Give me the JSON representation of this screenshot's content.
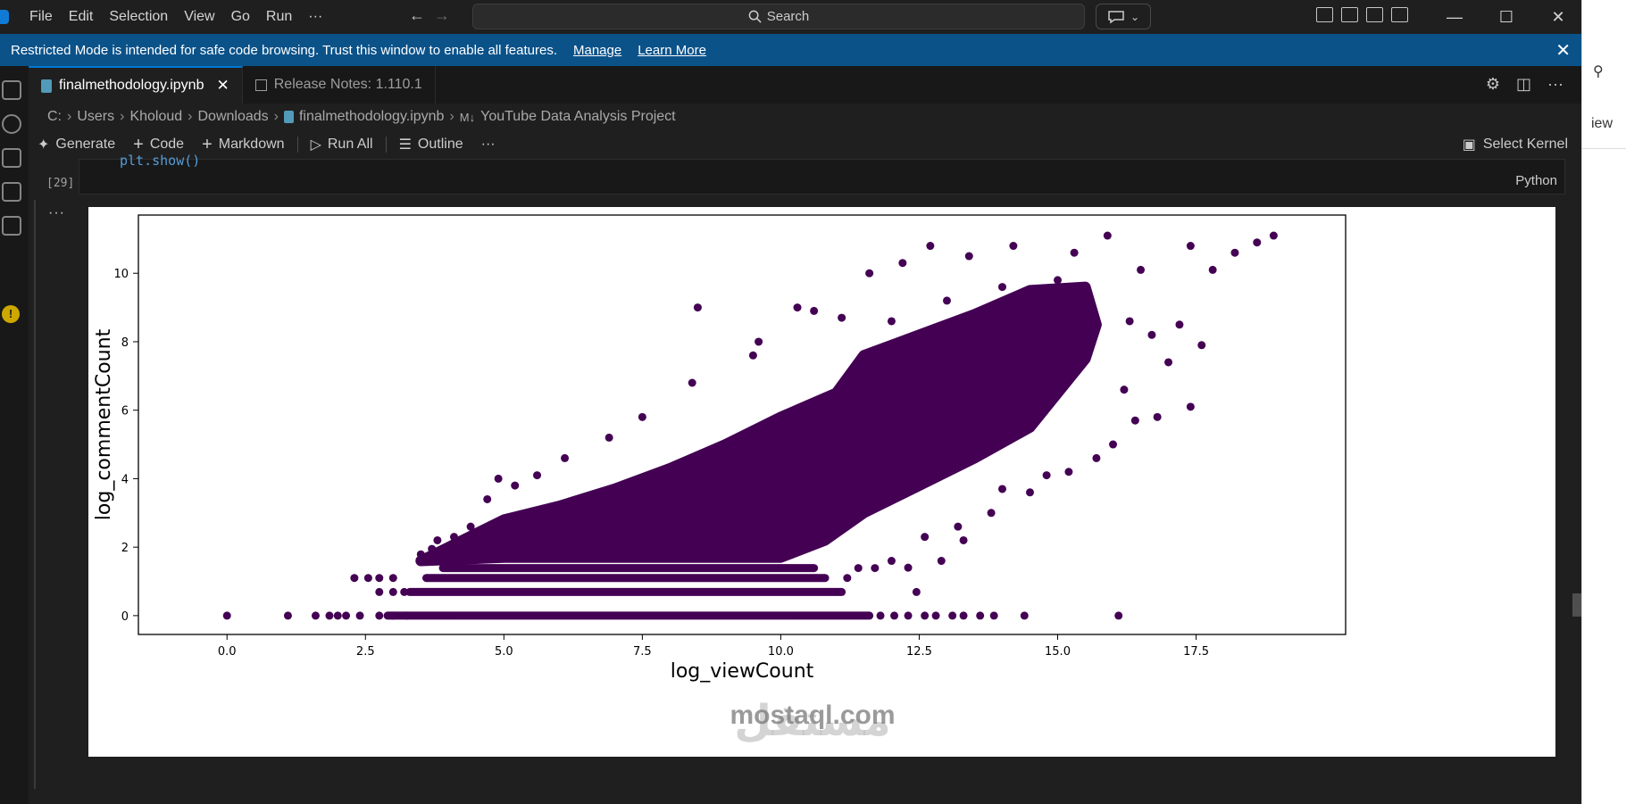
{
  "menu": [
    "File",
    "Edit",
    "Selection",
    "View",
    "Go",
    "Run",
    "···"
  ],
  "search": {
    "label": "Search"
  },
  "banner": {
    "message": "Restricted Mode is intended for safe code browsing. Trust this window to enable all features.",
    "manage": "Manage",
    "learn_more": "Learn More"
  },
  "tabs": [
    {
      "label": "finalmethodology.ipynb",
      "active": true
    },
    {
      "label": "Release Notes: 1.110.1",
      "active": false
    }
  ],
  "breadcrumb": [
    "C:",
    "Users",
    "Kholoud",
    "Downloads",
    "finalmethodology.ipynb",
    "YouTube Data Analysis Project"
  ],
  "toolbar": {
    "generate": "Generate",
    "code": "Code",
    "markdown": "Markdown",
    "run_all": "Run All",
    "outline": "Outline",
    "more": "···",
    "kernel": "Select Kernel"
  },
  "cell": {
    "code": "plt.show()",
    "execution_count": "[29]",
    "language": "Python",
    "output_menu": "···"
  },
  "side_window": {
    "text": "iew"
  },
  "watermark": {
    "latin": "mostaql.com",
    "arabic": "مستقل"
  },
  "colors": {
    "banner": "#0b5289",
    "accent": "#0078d4",
    "point": "#440154"
  },
  "chart_data": {
    "type": "scatter",
    "xlabel": "log_viewCount",
    "ylabel": "log_commentCount",
    "xlim": [
      -1.6,
      20.2
    ],
    "ylim": [
      -0.55,
      11.7
    ],
    "xticks": [
      0.0,
      2.5,
      5.0,
      7.5,
      10.0,
      12.5,
      15.0,
      17.5
    ],
    "yticks": [
      0,
      2,
      4,
      6,
      8,
      10
    ],
    "grid": false,
    "point_color": "#440154",
    "dense_region": [
      [
        3.5,
        1.6
      ],
      [
        4.0,
        2.0
      ],
      [
        5.0,
        2.8
      ],
      [
        6.0,
        3.2
      ],
      [
        7.0,
        3.7
      ],
      [
        8.0,
        4.3
      ],
      [
        9.0,
        5.0
      ],
      [
        10.0,
        5.8
      ],
      [
        11.0,
        6.5
      ],
      [
        11.5,
        7.6
      ],
      [
        12.5,
        8.2
      ],
      [
        13.5,
        8.8
      ],
      [
        14.5,
        9.5
      ],
      [
        15.5,
        9.6
      ],
      [
        15.7,
        8.5
      ],
      [
        15.5,
        7.5
      ],
      [
        15.0,
        6.5
      ],
      [
        14.5,
        5.5
      ],
      [
        13.5,
        4.6
      ],
      [
        12.5,
        3.8
      ],
      [
        11.5,
        3.0
      ],
      [
        10.8,
        2.2
      ],
      [
        10.0,
        1.7
      ],
      [
        7.0,
        1.7
      ],
      [
        5.0,
        1.7
      ]
    ],
    "bands": [
      {
        "y": 1.39,
        "x0": 3.9,
        "x1": 10.6
      },
      {
        "y": 1.1,
        "x0": 3.6,
        "x1": 10.8
      },
      {
        "y": 0.69,
        "x0": 3.3,
        "x1": 11.1
      },
      {
        "y": 0.0,
        "x0": 2.9,
        "x1": 11.6
      }
    ],
    "points": [
      [
        0.0,
        0.0
      ],
      [
        1.1,
        0.0
      ],
      [
        1.6,
        0.0
      ],
      [
        1.85,
        0.0
      ],
      [
        2.0,
        0.0
      ],
      [
        2.15,
        0.0
      ],
      [
        2.4,
        0.0
      ],
      [
        2.75,
        0.0
      ],
      [
        3.0,
        0.0
      ],
      [
        3.25,
        0.0
      ],
      [
        11.8,
        0.0
      ],
      [
        12.05,
        0.0
      ],
      [
        12.3,
        0.0
      ],
      [
        12.6,
        0.0
      ],
      [
        12.8,
        0.0
      ],
      [
        13.1,
        0.0
      ],
      [
        13.3,
        0.0
      ],
      [
        13.6,
        0.0
      ],
      [
        13.85,
        0.0
      ],
      [
        14.4,
        0.0
      ],
      [
        16.1,
        0.0
      ],
      [
        2.3,
        1.1
      ],
      [
        2.55,
        1.1
      ],
      [
        2.75,
        1.1
      ],
      [
        3.0,
        1.1
      ],
      [
        2.75,
        0.69
      ],
      [
        3.0,
        0.69
      ],
      [
        3.2,
        0.69
      ],
      [
        12.45,
        0.69
      ],
      [
        11.2,
        1.1
      ],
      [
        11.4,
        1.39
      ],
      [
        11.7,
        1.39
      ],
      [
        3.5,
        1.79
      ],
      [
        3.7,
        1.95
      ],
      [
        3.8,
        2.2
      ],
      [
        4.1,
        2.3
      ],
      [
        4.4,
        2.6
      ],
      [
        4.7,
        3.4
      ],
      [
        4.9,
        4.0
      ],
      [
        5.2,
        3.8
      ],
      [
        5.6,
        4.1
      ],
      [
        6.1,
        4.6
      ],
      [
        6.9,
        5.2
      ],
      [
        7.5,
        5.8
      ],
      [
        8.4,
        6.8
      ],
      [
        9.5,
        7.6
      ],
      [
        9.6,
        8.0
      ],
      [
        8.5,
        9.0
      ],
      [
        10.3,
        9.0
      ],
      [
        10.6,
        8.9
      ],
      [
        11.1,
        8.7
      ],
      [
        11.6,
        10.0
      ],
      [
        12.2,
        10.3
      ],
      [
        12.7,
        10.8
      ],
      [
        13.4,
        10.5
      ],
      [
        14.2,
        10.8
      ],
      [
        15.3,
        10.6
      ],
      [
        15.9,
        11.1
      ],
      [
        16.5,
        10.1
      ],
      [
        17.4,
        10.8
      ],
      [
        17.8,
        10.1
      ],
      [
        18.2,
        10.6
      ],
      [
        18.6,
        10.9
      ],
      [
        18.9,
        11.1
      ],
      [
        16.3,
        8.6
      ],
      [
        16.7,
        8.2
      ],
      [
        17.0,
        7.4
      ],
      [
        17.6,
        7.9
      ],
      [
        17.4,
        6.1
      ],
      [
        16.8,
        5.8
      ],
      [
        16.4,
        5.7
      ],
      [
        16.0,
        5.0
      ],
      [
        15.7,
        4.6
      ],
      [
        15.2,
        4.2
      ],
      [
        14.5,
        3.6
      ],
      [
        13.8,
        3.0
      ],
      [
        13.2,
        2.6
      ],
      [
        12.6,
        2.3
      ],
      [
        13.3,
        2.2
      ],
      [
        12.9,
        1.6
      ],
      [
        12.3,
        1.4
      ],
      [
        12.0,
        1.6
      ],
      [
        14.0,
        3.7
      ],
      [
        14.8,
        4.1
      ],
      [
        16.2,
        6.6
      ],
      [
        17.2,
        8.5
      ],
      [
        15.0,
        9.8
      ],
      [
        14.0,
        9.6
      ],
      [
        13.0,
        9.2
      ],
      [
        12.0,
        8.6
      ]
    ]
  }
}
